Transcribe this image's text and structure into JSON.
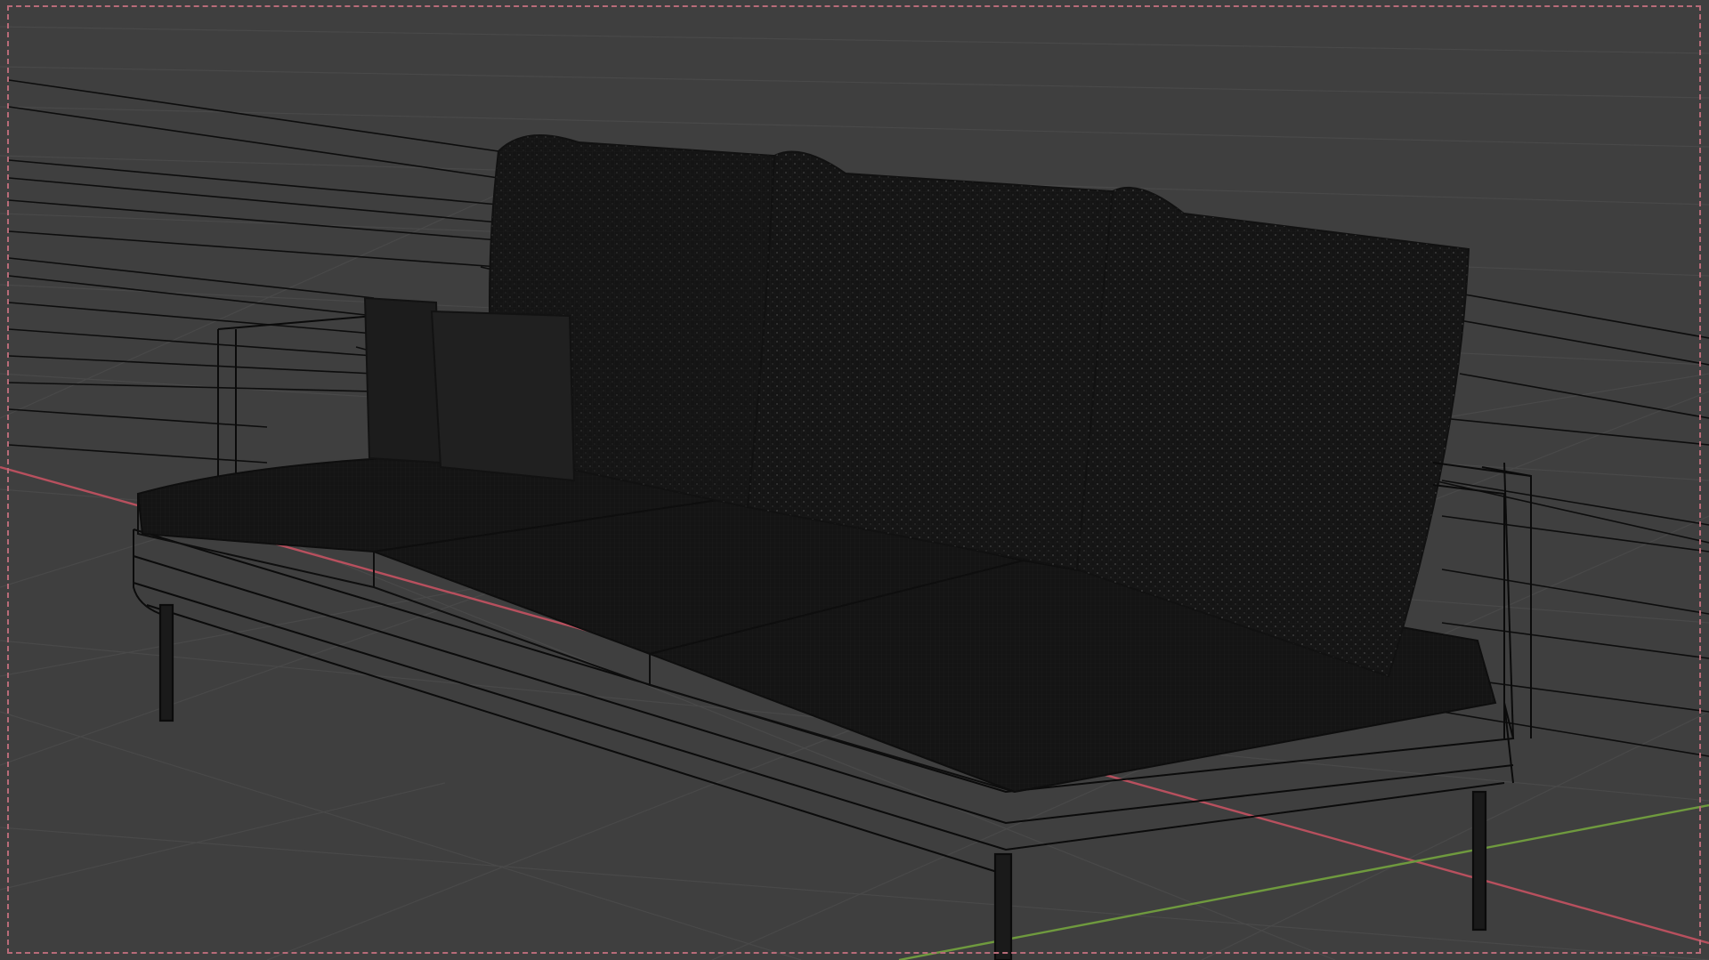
{
  "viewport": {
    "background_color": "#3f3f3f",
    "grid_color": "#4a4a4a",
    "x_axis_color": "#b8505e",
    "y_axis_color": "#6f9a3e",
    "camera_frame_color": "#b86b78",
    "wireframe_color": "#0b0b0b",
    "mesh_color": "#151515"
  },
  "scene": {
    "object": "sofa-mesh",
    "shading": "wireframe-overlay"
  }
}
